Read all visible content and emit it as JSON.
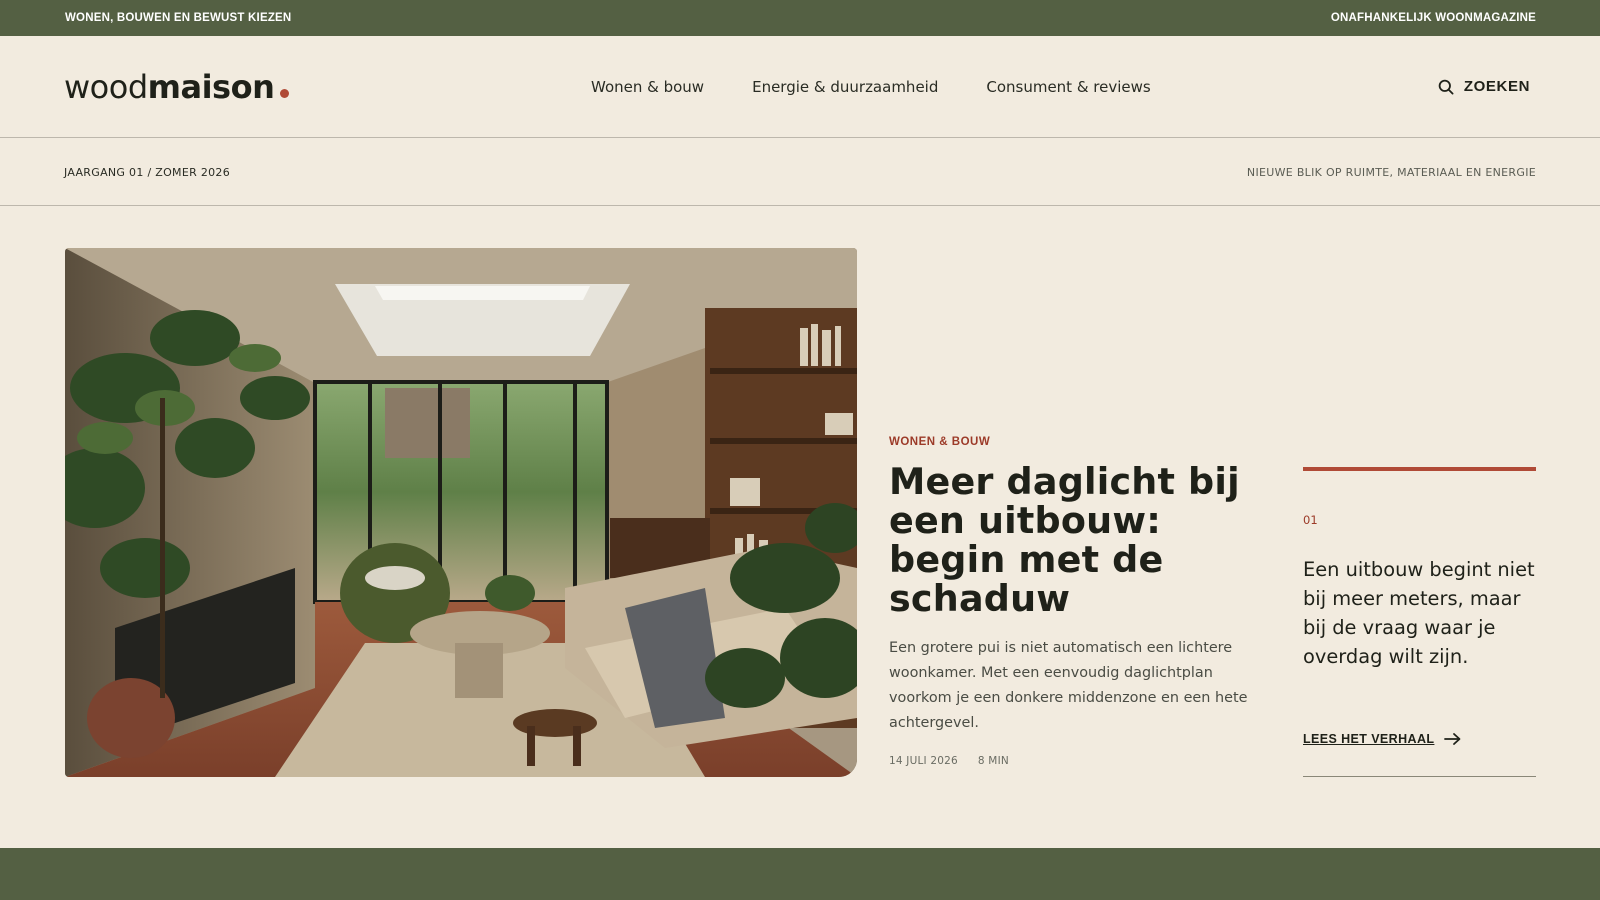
{
  "topbar": {
    "left": "WONEN, BOUWEN EN BEWUST KIEZEN",
    "right": "ONAFHANKELIJK WOONMAGAZINE"
  },
  "brand": {
    "light": "wood",
    "bold": "maison",
    "accent_color": "#b04a36"
  },
  "nav": {
    "items": [
      "Wonen & bouw",
      "Energie & duurzaamheid",
      "Consument & reviews"
    ]
  },
  "search": {
    "label": "ZOEKEN",
    "icon": "search-icon"
  },
  "subbar": {
    "issue": "JAARGANG 01 / ZOMER 2026",
    "tagline": "NIEUWE BLIK OP RUIMTE, MATERIAAL EN ENERGIE"
  },
  "feature": {
    "category": "WONEN & BOUW",
    "title": "Meer daglicht bij een uitbouw: begin met de schaduw",
    "lede": "Een grotere pui is niet automatisch een lichtere woonkamer. Met een eenvoudig daglichtplan voorkom je een donkere middenzone en een hete achtergevel.",
    "date": "14 JULI 2026",
    "read_time": "8 MIN"
  },
  "aside": {
    "number": "01",
    "quote": "Een uitbouw begint niet bij meer meters, maar bij de vraag waar je overdag wilt zijn.",
    "link_label": "LEES HET VERHAAL",
    "link_icon": "arrow-right-icon"
  },
  "colors": {
    "olive": "#546043",
    "cream": "#f2ebdf",
    "terracotta": "#b04a36"
  }
}
